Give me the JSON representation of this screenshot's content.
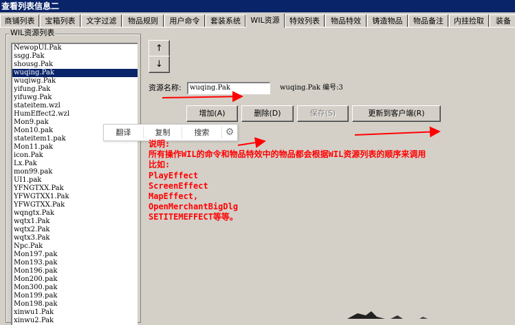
{
  "window": {
    "title": "查看列表信息二"
  },
  "tabs": [
    {
      "label": "商铺列表"
    },
    {
      "label": "宝箱列表"
    },
    {
      "label": "文字过滤"
    },
    {
      "label": "物品规则"
    },
    {
      "label": "用户命令"
    },
    {
      "label": "套装系统"
    },
    {
      "label": "WIL资源"
    },
    {
      "label": "特效列表"
    },
    {
      "label": "物品特效"
    },
    {
      "label": "铸造物品"
    },
    {
      "label": "物品备注"
    },
    {
      "label": "内挂捡取"
    },
    {
      "label": "装备"
    }
  ],
  "active_tab": "WIL资源",
  "list_panel": {
    "legend": "WIL资源列表",
    "items": [
      "NewopUI.Pak",
      "ssgg.Pak",
      "shousg.Pak",
      "wuqing.Pak",
      "wuqiwg.Pak",
      "yifung.Pak",
      "yifuwg.Pak",
      "stateitem.wzl",
      "HumEffect2.wzl",
      "Mon9.pak",
      "Mon10.pak",
      "stateitem1.pak",
      "Mon11.pak",
      "icon.Pak",
      "Lx.Pak",
      "mon99.pak",
      "UI1.pak",
      "YFNGTXX.Pak",
      "YFWGTXX1.Pak",
      "YFWGTXX.Pak",
      "wqngtx.Pak",
      "wqtx1.Pak",
      "wqtx2.Pak",
      "wqtx3.Pak",
      "Npc.Pak",
      "Mon197.pak",
      "Mon193.pak",
      "Mon196.pak",
      "Mon200.pak",
      "Mon300.pak",
      "Mon199.pak",
      "Mon198.pak",
      "xinwu1.Pak",
      "xinwu2.Pak"
    ],
    "selected": "wuqing.Pak"
  },
  "arrows": {
    "up": "↑",
    "down": "↓"
  },
  "resource": {
    "name_label": "资源名称:",
    "name_value": "wuqing.Pak",
    "info": "wuqing.Pak 编号:3"
  },
  "buttons": {
    "add": "增加(A)",
    "delete": "删除(D)",
    "save": "保存(S)",
    "update_client": "更新到客户端(R)"
  },
  "popup": {
    "translate": "翻译",
    "copy": "复制",
    "search": "搜索"
  },
  "note": {
    "lines": [
      "说明:",
      "所有操作WIL的命令和物品特效中的物品都会根据WIL资源列表的顺序来调用",
      "比如:",
      "PlayEffect",
      "ScreenEffect",
      "MapEffect,",
      "OpenMerchantBigDlg",
      "SETITEMEFFECT等等。"
    ]
  },
  "colors": {
    "titlebar": "#0a246a",
    "selection": "#0a246a",
    "annotation": "#ff0000",
    "face": "#d4d0c8"
  }
}
